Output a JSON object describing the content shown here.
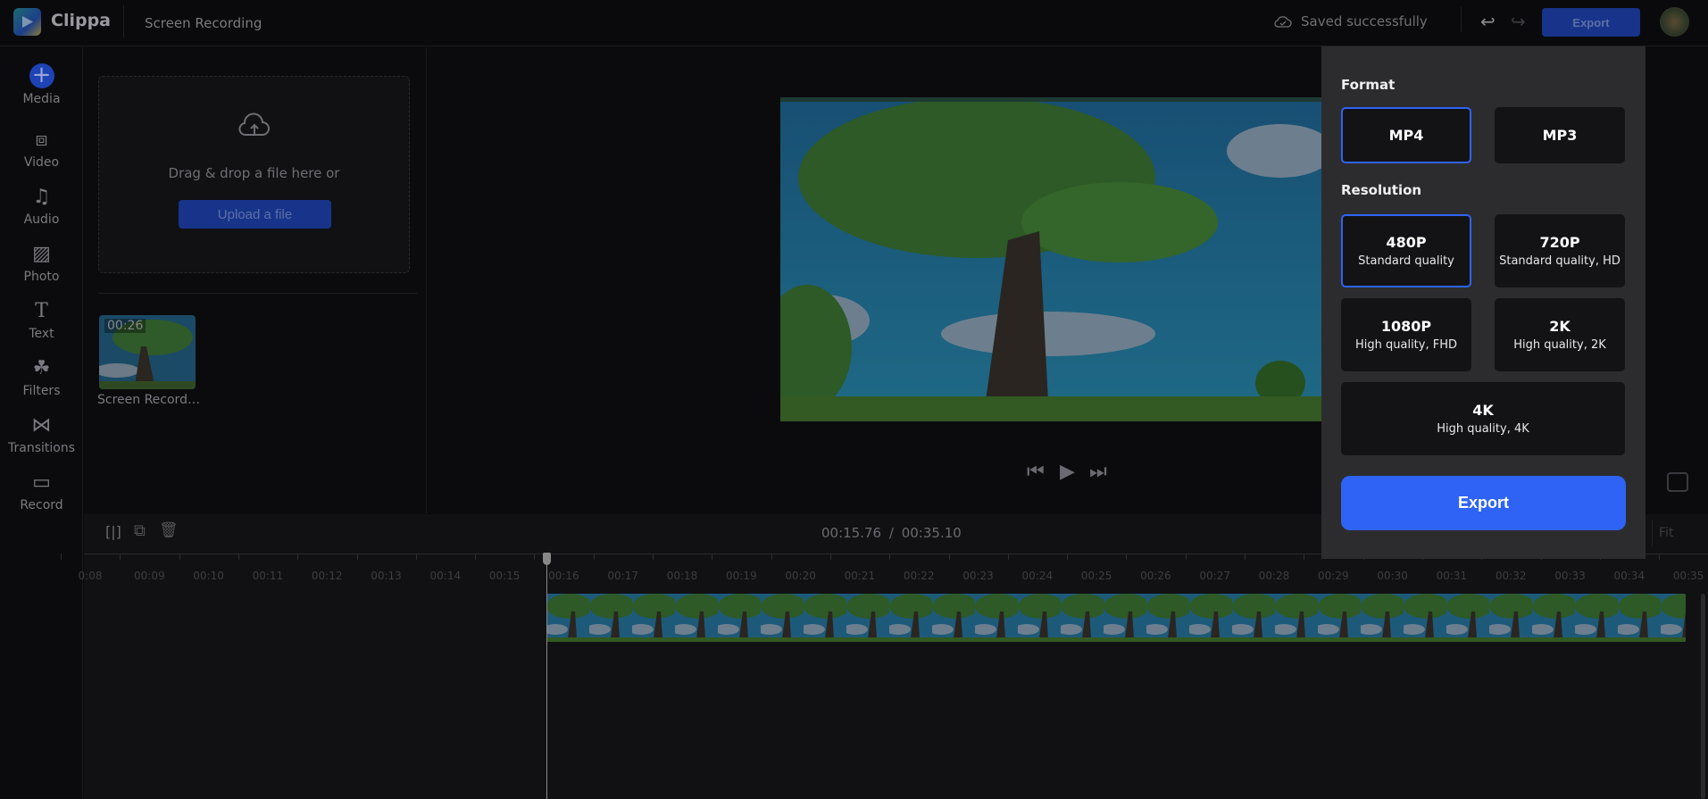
{
  "header": {
    "brand": "Clippa",
    "project_title": "Screen Recording",
    "save_status": "Saved successfully",
    "undo_icon": "undo-icon",
    "redo_icon": "redo-icon",
    "export_label": "Export"
  },
  "sidebar": {
    "items": [
      {
        "label": "Media",
        "icon": "plus-icon"
      },
      {
        "label": "Video",
        "icon": "video-icon"
      },
      {
        "label": "Audio",
        "icon": "music-icon"
      },
      {
        "label": "Photo",
        "icon": "image-icon"
      },
      {
        "label": "Text",
        "icon": "text-icon"
      },
      {
        "label": "Filters",
        "icon": "filters-icon"
      },
      {
        "label": "Transitions",
        "icon": "transition-icon"
      },
      {
        "label": "Record",
        "icon": "camera-icon"
      }
    ]
  },
  "media": {
    "drop_text": "Drag & drop a file here or",
    "upload_label": "Upload a file",
    "files": [
      {
        "name": "Screen Recordi...",
        "duration": "00:26"
      }
    ]
  },
  "player": {
    "current_time": "00:15.76",
    "separator": "/",
    "total_time": "00:35.10",
    "fit_label": "Fit"
  },
  "timeline": {
    "ruler": [
      "0:08",
      "00:09",
      "00:10",
      "00:11",
      "00:12",
      "00:13",
      "00:14",
      "00:15",
      "00:16",
      "00:17",
      "00:18",
      "00:19",
      "00:20",
      "00:21",
      "00:22",
      "00:23",
      "00:24",
      "00:25",
      "00:26",
      "00:27",
      "00:28",
      "00:29",
      "00:30",
      "00:31",
      "00:32",
      "00:33",
      "00:34",
      "00:35"
    ]
  },
  "export_panel": {
    "format_label": "Format",
    "formats": [
      {
        "label": "MP4",
        "selected": true
      },
      {
        "label": "MP3",
        "selected": false
      }
    ],
    "resolution_label": "Resolution",
    "resolutions": [
      {
        "label": "480P",
        "desc": "Standard quality",
        "selected": true
      },
      {
        "label": "720P",
        "desc": "Standard quality, HD",
        "selected": false
      },
      {
        "label": "1080P",
        "desc": "High quality, FHD",
        "selected": false
      },
      {
        "label": "2K",
        "desc": "High quality, 2K",
        "selected": false
      },
      {
        "label": "4K",
        "desc": "High quality, 4K",
        "selected": false
      }
    ],
    "export_label": "Export"
  },
  "colors": {
    "accent": "#2e63f5",
    "dim_accent": "#17348a",
    "panel": "#2c2c2f"
  }
}
